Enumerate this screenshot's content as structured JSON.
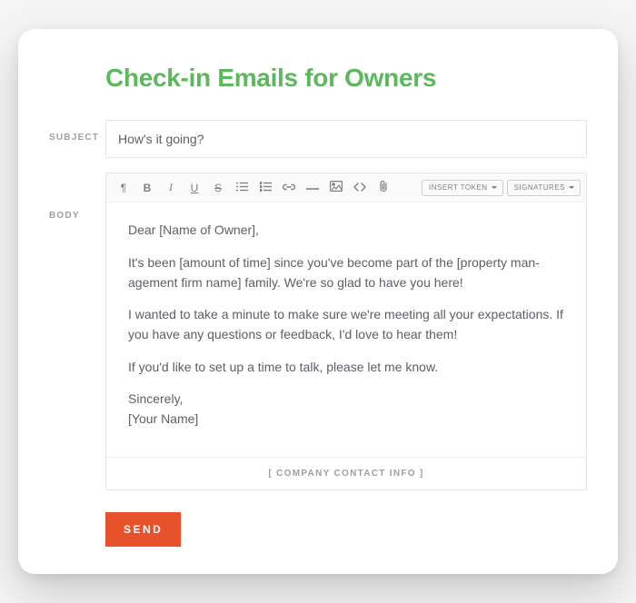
{
  "title": "Check-in Emails for Owners",
  "labels": {
    "subject": "SUBJECT",
    "body": "BODY"
  },
  "subject_value": "How's it going?",
  "toolbar": {
    "paragraph": "¶",
    "bold": "B",
    "italic": "I",
    "underline": "U",
    "strike": "S",
    "insert_token": "INSERT TOKEN",
    "signatures": "SIGNATURES"
  },
  "body_text": {
    "p1": "Dear [Name of Owner],",
    "p2": "It's been [amount of time] since you've become part of the [property man­agement firm name] family. We're so glad to have you here!",
    "p3": "I wanted to take a minute to make sure we're meeting all your expecta­tions. If you have any questions or feedback, I'd love to hear them!",
    "p4": "If you'd like to set up a time to talk, please let me know.",
    "p5": "Sincerely,",
    "p6": "[Your Name]"
  },
  "footer": "[ COMPANY CONTACT INFO ]",
  "send_label": "SEND"
}
